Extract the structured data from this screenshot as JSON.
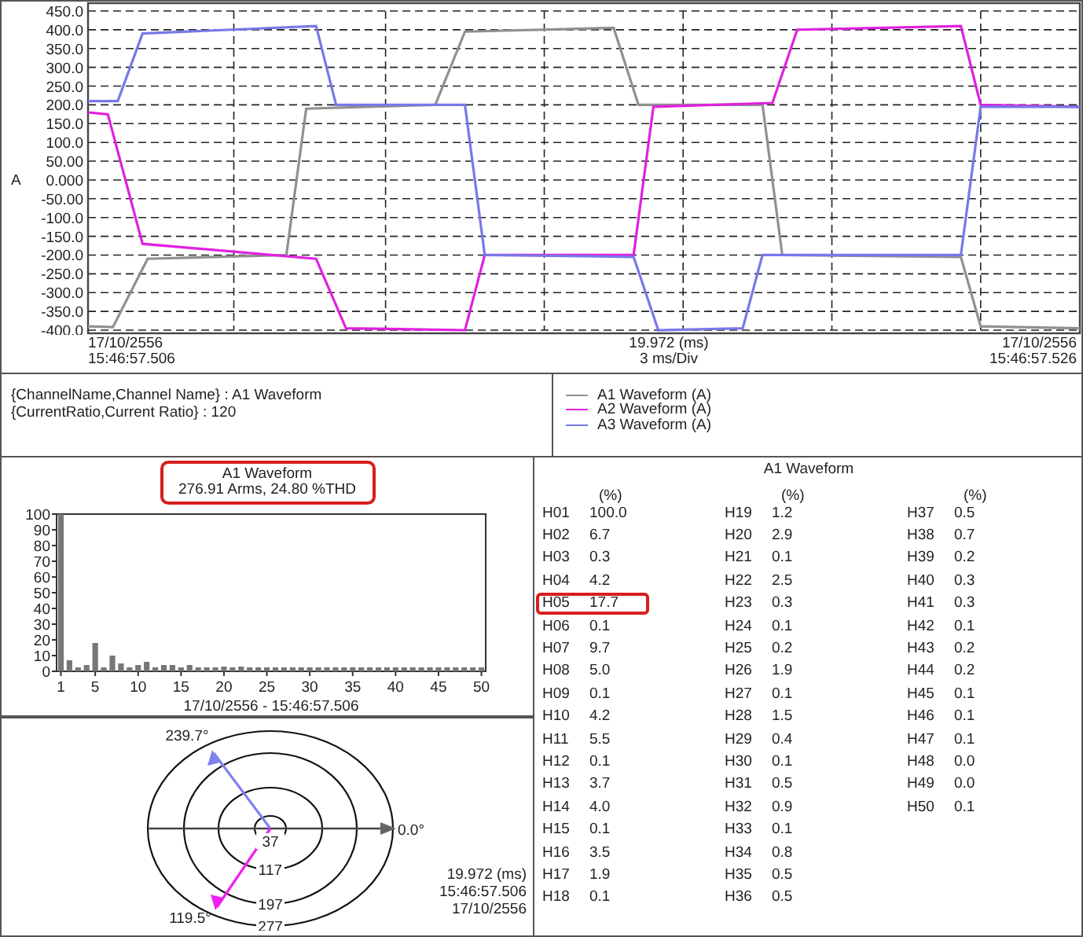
{
  "waveform_chart": {
    "y_unit": "A",
    "y_axis_labels": [
      "450.0",
      "400.0",
      "350.0",
      "300.0",
      "250.0",
      "200.0",
      "150.0",
      "100.0",
      "50.00",
      "0.000",
      "-50.00",
      "-100.0",
      "-150.0",
      "-200.0",
      "-250.0",
      "-300.0",
      "-350.0",
      "-400.0"
    ],
    "start": {
      "date": "17/10/2556",
      "time": "15:46:57.506"
    },
    "center": {
      "time": "19.972 (ms)",
      "scale": "3 ms/Div"
    },
    "end": {
      "date": "17/10/2556",
      "time": "15:46:57.526"
    }
  },
  "info": {
    "lines": [
      "{ChannelName,Channel Name} : A1 Waveform",
      "{CurrentRatio,Current Ratio} :  120"
    ]
  },
  "legend": [
    {
      "label": "A1 Waveform (A)",
      "color": "#909090"
    },
    {
      "label": "A2 Waveform (A)",
      "color": "#e020e0"
    },
    {
      "label": "A3 Waveform (A)",
      "color": "#7878e8"
    }
  ],
  "harmonic_chart": {
    "title": "A1 Waveform",
    "summary": "276.91 Arms, 24.80 %THD",
    "highlighted": true,
    "chart_data": {
      "type": "bar",
      "xlabel": "17/10/2556 - 15:46:57.506",
      "x": [
        1,
        2,
        3,
        4,
        5,
        6,
        7,
        8,
        9,
        10,
        11,
        12,
        13,
        14,
        15,
        16,
        17,
        18,
        19,
        20,
        21,
        22,
        23,
        24,
        25,
        26,
        27,
        28,
        29,
        30,
        31,
        32,
        33,
        34,
        35,
        36,
        37,
        38,
        39,
        40,
        41,
        42,
        43,
        44,
        45,
        46,
        47,
        48,
        49,
        50
      ],
      "values": [
        100,
        7,
        0,
        4,
        18,
        0,
        10,
        5,
        0,
        4,
        6,
        0,
        4,
        4,
        0,
        4,
        2,
        0,
        1,
        3,
        0,
        3,
        0,
        0,
        0,
        2,
        0,
        2,
        0,
        0,
        1,
        1,
        0,
        1,
        1,
        1,
        1,
        1,
        0,
        0,
        0,
        0,
        0,
        0,
        0,
        0,
        0,
        0,
        0,
        0
      ],
      "ylim": [
        0,
        100
      ],
      "xlim": [
        0.5,
        50.5
      ],
      "yticks": [
        0,
        10,
        20,
        30,
        40,
        50,
        60,
        70,
        80,
        90,
        100
      ],
      "xticks": [
        1,
        5,
        10,
        15,
        20,
        25,
        30,
        35,
        40,
        45,
        50
      ]
    }
  },
  "phasor": {
    "rings": [
      "37",
      "117",
      "197",
      "277"
    ],
    "reference_label": "0.0°",
    "vectors": [
      {
        "label": "239.7°",
        "color": "#8080f0"
      },
      {
        "label": "119.5°",
        "color": "#f020f0"
      }
    ],
    "readout": [
      "19.972 (ms)",
      "15:46:57.506",
      "17/10/2556"
    ]
  },
  "harmonics_table": {
    "title": "A1 Waveform",
    "columns": [
      {
        "unit": "(%)",
        "rows": [
          {
            "order": "H01",
            "value": "100.0",
            "highlighted": false
          },
          {
            "order": "H02",
            "value": "6.7",
            "highlighted": false
          },
          {
            "order": "H03",
            "value": "0.3",
            "highlighted": false
          },
          {
            "order": "H04",
            "value": "4.2",
            "highlighted": false
          },
          {
            "order": "H05",
            "value": "17.7",
            "highlighted": true
          },
          {
            "order": "H06",
            "value": "0.1",
            "highlighted": false
          },
          {
            "order": "H07",
            "value": "9.7",
            "highlighted": false
          },
          {
            "order": "H08",
            "value": "5.0",
            "highlighted": false
          },
          {
            "order": "H09",
            "value": "0.1",
            "highlighted": false
          },
          {
            "order": "H10",
            "value": "4.2",
            "highlighted": false
          },
          {
            "order": "H11",
            "value": "5.5",
            "highlighted": false
          },
          {
            "order": "H12",
            "value": "0.1",
            "highlighted": false
          },
          {
            "order": "H13",
            "value": "3.7",
            "highlighted": false
          },
          {
            "order": "H14",
            "value": "4.0",
            "highlighted": false
          },
          {
            "order": "H15",
            "value": "0.1",
            "highlighted": false
          },
          {
            "order": "H16",
            "value": "3.5",
            "highlighted": false
          },
          {
            "order": "H17",
            "value": "1.9",
            "highlighted": false
          },
          {
            "order": "H18",
            "value": "0.1",
            "highlighted": false
          }
        ]
      },
      {
        "unit": "(%)",
        "rows": [
          {
            "order": "H19",
            "value": "1.2",
            "highlighted": false
          },
          {
            "order": "H20",
            "value": "2.9",
            "highlighted": false
          },
          {
            "order": "H21",
            "value": "0.1",
            "highlighted": false
          },
          {
            "order": "H22",
            "value": "2.5",
            "highlighted": false
          },
          {
            "order": "H23",
            "value": "0.3",
            "highlighted": false
          },
          {
            "order": "H24",
            "value": "0.1",
            "highlighted": false
          },
          {
            "order": "H25",
            "value": "0.2",
            "highlighted": false
          },
          {
            "order": "H26",
            "value": "1.9",
            "highlighted": false
          },
          {
            "order": "H27",
            "value": "0.1",
            "highlighted": false
          },
          {
            "order": "H28",
            "value": "1.5",
            "highlighted": false
          },
          {
            "order": "H29",
            "value": "0.4",
            "highlighted": false
          },
          {
            "order": "H30",
            "value": "0.1",
            "highlighted": false
          },
          {
            "order": "H31",
            "value": "0.5",
            "highlighted": false
          },
          {
            "order": "H32",
            "value": "0.9",
            "highlighted": false
          },
          {
            "order": "H33",
            "value": "0.1",
            "highlighted": false
          },
          {
            "order": "H34",
            "value": "0.8",
            "highlighted": false
          },
          {
            "order": "H35",
            "value": "0.5",
            "highlighted": false
          },
          {
            "order": "H36",
            "value": "0.5",
            "highlighted": false
          }
        ]
      },
      {
        "unit": "(%)",
        "rows": [
          {
            "order": "H37",
            "value": "0.5",
            "highlighted": false
          },
          {
            "order": "H38",
            "value": "0.7",
            "highlighted": false
          },
          {
            "order": "H39",
            "value": "0.2",
            "highlighted": false
          },
          {
            "order": "H40",
            "value": "0.3",
            "highlighted": false
          },
          {
            "order": "H41",
            "value": "0.3",
            "highlighted": false
          },
          {
            "order": "H42",
            "value": "0.1",
            "highlighted": false
          },
          {
            "order": "H43",
            "value": "0.2",
            "highlighted": false
          },
          {
            "order": "H44",
            "value": "0.2",
            "highlighted": false
          },
          {
            "order": "H45",
            "value": "0.1",
            "highlighted": false
          },
          {
            "order": "H46",
            "value": "0.1",
            "highlighted": false
          },
          {
            "order": "H47",
            "value": "0.1",
            "highlighted": false
          },
          {
            "order": "H48",
            "value": "0.0",
            "highlighted": false
          },
          {
            "order": "H49",
            "value": "0.0",
            "highlighted": false
          },
          {
            "order": "H50",
            "value": "0.1",
            "highlighted": false
          }
        ]
      }
    ]
  }
}
